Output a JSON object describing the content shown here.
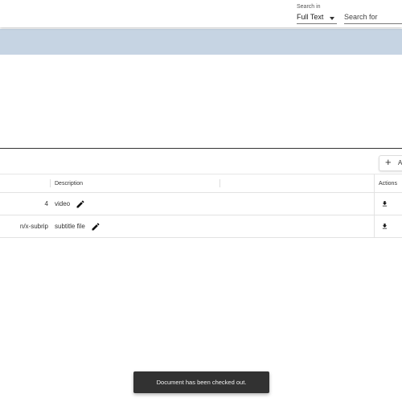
{
  "header": {
    "search_in_label": "Search in",
    "search_in_value": "Full Text",
    "search_placeholder": "Search for"
  },
  "attachments": {
    "add_button_label": "A",
    "columns": {
      "type": "",
      "description": "Description",
      "extra": "",
      "actions": "Actions"
    },
    "rows": [
      {
        "type": "4",
        "description": "video"
      },
      {
        "type": "n/x-subrip",
        "description": "subtitle file"
      }
    ]
  },
  "snackbar": {
    "message": "Document has been checked out."
  },
  "icons": {
    "search_in_caret": "caret-down-icon",
    "add": "plus-icon",
    "edit": "pencil-icon",
    "download": "download-icon"
  },
  "colors": {
    "band": "#c6d4e3",
    "snackbar_bg": "#323232"
  }
}
